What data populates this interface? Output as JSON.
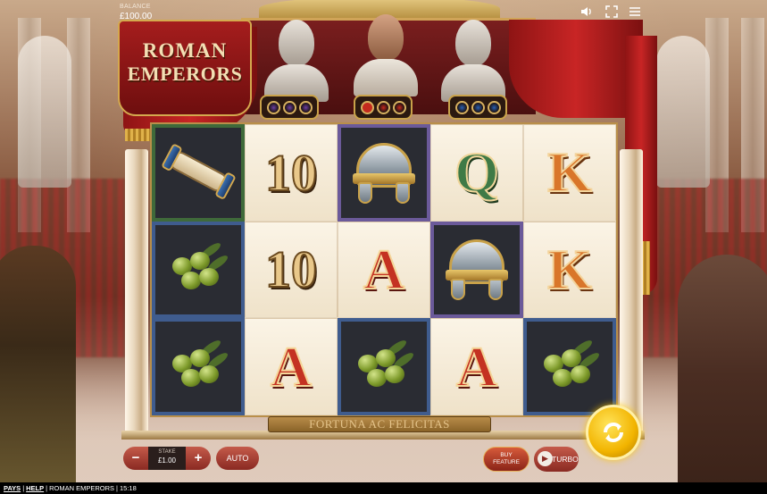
{
  "topbar": {
    "balance_label": "BALANCE",
    "balance_value": "£100.00",
    "icons": [
      "sound-icon",
      "fullscreen-icon",
      "menu-icon"
    ]
  },
  "logo": {
    "line1": "ROMAN",
    "line2": "EMPERORS"
  },
  "emperor_meters": [
    {
      "orb_color": "#6b3fa0",
      "filled": 0
    },
    {
      "orb_color": "#c42a1e",
      "filled": 1
    },
    {
      "orb_color": "#2a5fb0",
      "filled": 0
    }
  ],
  "reels": [
    [
      "scroll",
      "olives",
      "olives"
    ],
    [
      "10",
      "10",
      "A"
    ],
    [
      "helmet",
      "A",
      "olives"
    ],
    [
      "Q",
      "helmet",
      "A"
    ],
    [
      "K",
      "K",
      "olives"
    ]
  ],
  "plaque": "FORTUNA AC FELICITAS",
  "controls": {
    "minus": "−",
    "plus": "+",
    "stake_label": "STAKE",
    "stake_value": "£1.00",
    "auto": "AUTO",
    "buy_feature_line1": "BUY",
    "buy_feature_line2": "FEATURE",
    "turbo": "TURBO"
  },
  "footer": {
    "pays": "PAYS",
    "help": "HELP",
    "game": "ROMAN EMPERORS",
    "time": "15:18"
  }
}
